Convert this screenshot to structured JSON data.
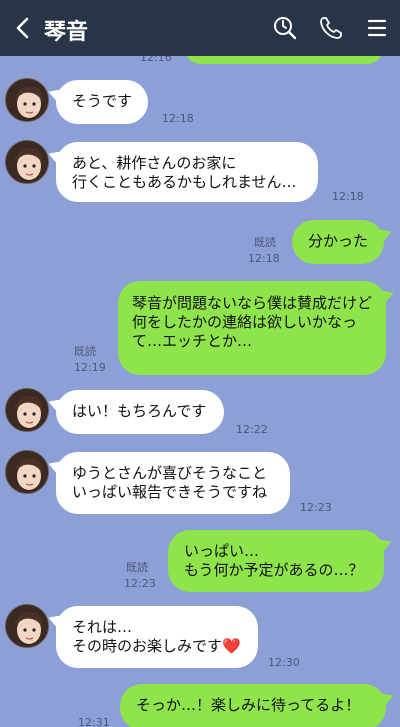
{
  "header": {
    "title": "琴音",
    "back_icon": "chevron-left-icon",
    "search_icon": "search-icon",
    "call_icon": "phone-icon",
    "menu_icon": "menu-icon"
  },
  "messages": [
    {
      "side": "out",
      "text": "",
      "time": "12:16"
    },
    {
      "side": "in",
      "text": "そうです",
      "time": "12:18"
    },
    {
      "side": "in",
      "text": "あと、耕作さんのお家に\n行くこともあるかもしれません…",
      "time": "12:18"
    },
    {
      "side": "out",
      "text": "分かった",
      "read": "既読",
      "time": "12:18"
    },
    {
      "side": "out",
      "text": "琴音が問題ないなら僕は賛成だけど\n何をしたかの連絡は欲しいかなって…エッチとか…",
      "read": "既読",
      "time": "12:19"
    },
    {
      "side": "in",
      "text": "はい！もちろんです",
      "time": "12:22"
    },
    {
      "side": "in",
      "text": "ゆうとさんが喜びそうなこと\nいっぱい報告できそうですね",
      "time": "12:23"
    },
    {
      "side": "out",
      "text": "いっぱい…\nもう何か予定があるの…？",
      "read": "既読",
      "time": "12:23"
    },
    {
      "side": "in",
      "text": "それは…\nその時のお楽しみです❤️",
      "time": "12:30"
    },
    {
      "side": "out",
      "text": "そっか…！楽しみに待ってるよ！",
      "read": "",
      "time": "12:31"
    }
  ]
}
